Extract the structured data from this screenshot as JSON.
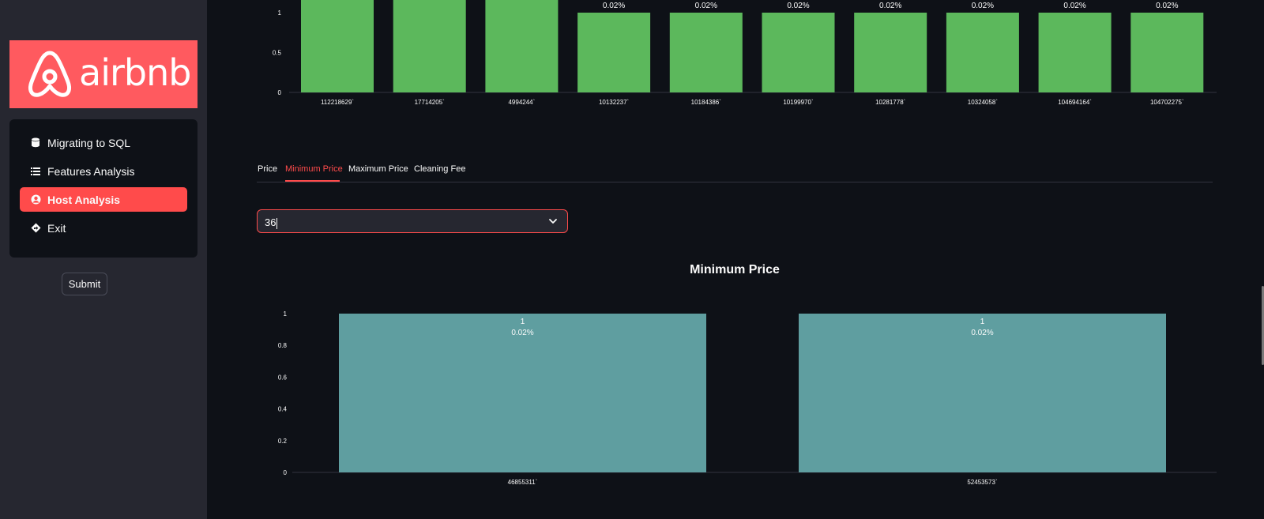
{
  "sidebar": {
    "logo_text": "airbnb",
    "menu": [
      {
        "label": "Migrating to SQL",
        "icon": "database-icon",
        "active": false
      },
      {
        "label": "Features Analysis",
        "icon": "list-icon",
        "active": false
      },
      {
        "label": "Host Analysis",
        "icon": "user-circle-icon",
        "active": true
      },
      {
        "label": "Exit",
        "icon": "diamond-arrow-icon",
        "active": false
      }
    ],
    "submit_label": "Submit"
  },
  "tabs": [
    {
      "label": "Price",
      "active": false
    },
    {
      "label": "Minimum Price",
      "active": true
    },
    {
      "label": "Maximum Price",
      "active": false
    },
    {
      "label": "Cleaning Fee",
      "active": false
    }
  ],
  "select": {
    "value": "36"
  },
  "colors": {
    "accent": "#ff4b4b",
    "top_bar": "#5cb85c",
    "bottom_bar": "#5f9ea0",
    "logo_bg": "#ff5a5f"
  },
  "chart_data": [
    {
      "type": "bar",
      "categories": [
        "112218629`",
        "17714205`",
        "4994244`",
        "10132237`",
        "10184386`",
        "10199970`",
        "10281778`",
        "10324058`",
        "104694164`",
        "104702275`"
      ],
      "values": [
        1.2,
        1.2,
        1.2,
        1,
        1,
        1,
        1,
        1,
        1,
        1
      ],
      "labels": [
        "",
        "",
        "",
        "0.02%",
        "0.02%",
        "0.02%",
        "0.02%",
        "0.02%",
        "0.02%",
        "0.02%"
      ],
      "yticks": [
        "0",
        "0.5",
        "1"
      ]
    },
    {
      "type": "bar",
      "title": "Minimum Price",
      "categories": [
        "46855311`",
        "52453573`"
      ],
      "values": [
        1,
        1
      ],
      "labels_count": [
        "1",
        "1"
      ],
      "labels_pct": [
        "0.02%",
        "0.02%"
      ],
      "yticks": [
        "0",
        "0.2",
        "0.4",
        "0.6",
        "0.8",
        "1"
      ],
      "ylim": [
        0,
        1
      ]
    }
  ]
}
